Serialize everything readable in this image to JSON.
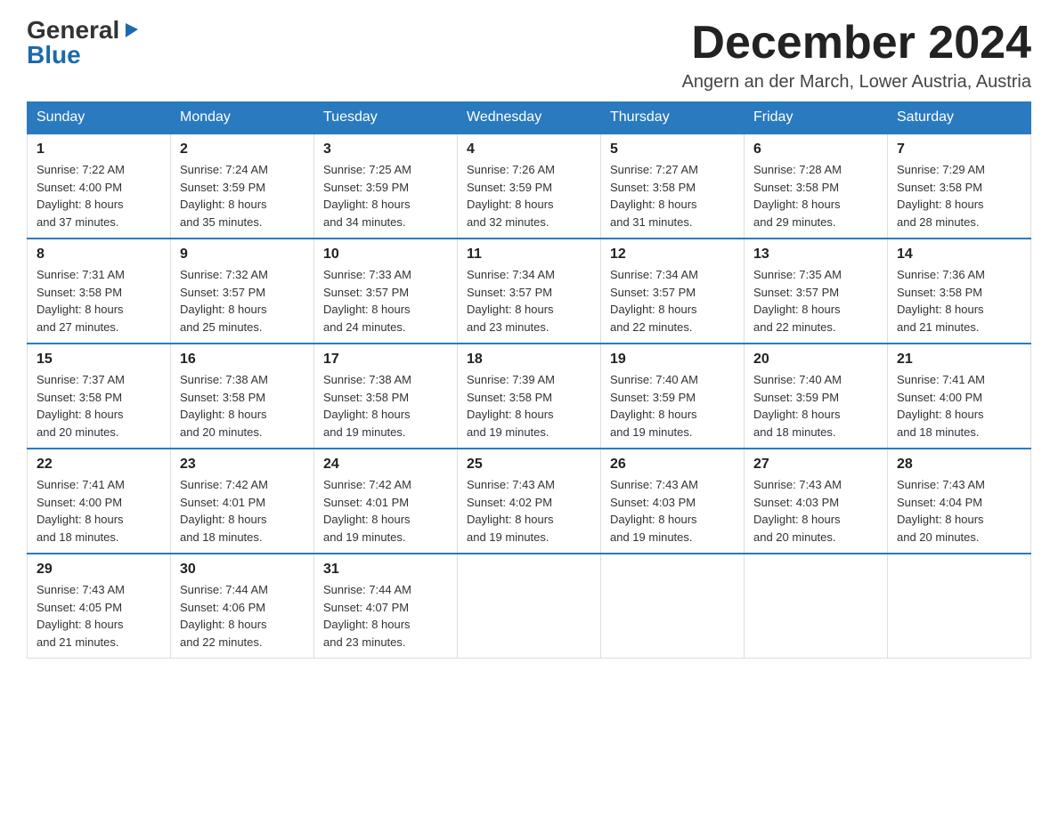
{
  "logo": {
    "general": "General",
    "blue": "Blue",
    "triangle_alt": "▶"
  },
  "header": {
    "month_title": "December 2024",
    "subtitle": "Angern an der March, Lower Austria, Austria"
  },
  "weekdays": [
    "Sunday",
    "Monday",
    "Tuesday",
    "Wednesday",
    "Thursday",
    "Friday",
    "Saturday"
  ],
  "weeks": [
    [
      {
        "day": "1",
        "sunrise": "Sunrise: 7:22 AM",
        "sunset": "Sunset: 4:00 PM",
        "daylight": "Daylight: 8 hours",
        "daylight2": "and 37 minutes."
      },
      {
        "day": "2",
        "sunrise": "Sunrise: 7:24 AM",
        "sunset": "Sunset: 3:59 PM",
        "daylight": "Daylight: 8 hours",
        "daylight2": "and 35 minutes."
      },
      {
        "day": "3",
        "sunrise": "Sunrise: 7:25 AM",
        "sunset": "Sunset: 3:59 PM",
        "daylight": "Daylight: 8 hours",
        "daylight2": "and 34 minutes."
      },
      {
        "day": "4",
        "sunrise": "Sunrise: 7:26 AM",
        "sunset": "Sunset: 3:59 PM",
        "daylight": "Daylight: 8 hours",
        "daylight2": "and 32 minutes."
      },
      {
        "day": "5",
        "sunrise": "Sunrise: 7:27 AM",
        "sunset": "Sunset: 3:58 PM",
        "daylight": "Daylight: 8 hours",
        "daylight2": "and 31 minutes."
      },
      {
        "day": "6",
        "sunrise": "Sunrise: 7:28 AM",
        "sunset": "Sunset: 3:58 PM",
        "daylight": "Daylight: 8 hours",
        "daylight2": "and 29 minutes."
      },
      {
        "day": "7",
        "sunrise": "Sunrise: 7:29 AM",
        "sunset": "Sunset: 3:58 PM",
        "daylight": "Daylight: 8 hours",
        "daylight2": "and 28 minutes."
      }
    ],
    [
      {
        "day": "8",
        "sunrise": "Sunrise: 7:31 AM",
        "sunset": "Sunset: 3:58 PM",
        "daylight": "Daylight: 8 hours",
        "daylight2": "and 27 minutes."
      },
      {
        "day": "9",
        "sunrise": "Sunrise: 7:32 AM",
        "sunset": "Sunset: 3:57 PM",
        "daylight": "Daylight: 8 hours",
        "daylight2": "and 25 minutes."
      },
      {
        "day": "10",
        "sunrise": "Sunrise: 7:33 AM",
        "sunset": "Sunset: 3:57 PM",
        "daylight": "Daylight: 8 hours",
        "daylight2": "and 24 minutes."
      },
      {
        "day": "11",
        "sunrise": "Sunrise: 7:34 AM",
        "sunset": "Sunset: 3:57 PM",
        "daylight": "Daylight: 8 hours",
        "daylight2": "and 23 minutes."
      },
      {
        "day": "12",
        "sunrise": "Sunrise: 7:34 AM",
        "sunset": "Sunset: 3:57 PM",
        "daylight": "Daylight: 8 hours",
        "daylight2": "and 22 minutes."
      },
      {
        "day": "13",
        "sunrise": "Sunrise: 7:35 AM",
        "sunset": "Sunset: 3:57 PM",
        "daylight": "Daylight: 8 hours",
        "daylight2": "and 22 minutes."
      },
      {
        "day": "14",
        "sunrise": "Sunrise: 7:36 AM",
        "sunset": "Sunset: 3:58 PM",
        "daylight": "Daylight: 8 hours",
        "daylight2": "and 21 minutes."
      }
    ],
    [
      {
        "day": "15",
        "sunrise": "Sunrise: 7:37 AM",
        "sunset": "Sunset: 3:58 PM",
        "daylight": "Daylight: 8 hours",
        "daylight2": "and 20 minutes."
      },
      {
        "day": "16",
        "sunrise": "Sunrise: 7:38 AM",
        "sunset": "Sunset: 3:58 PM",
        "daylight": "Daylight: 8 hours",
        "daylight2": "and 20 minutes."
      },
      {
        "day": "17",
        "sunrise": "Sunrise: 7:38 AM",
        "sunset": "Sunset: 3:58 PM",
        "daylight": "Daylight: 8 hours",
        "daylight2": "and 19 minutes."
      },
      {
        "day": "18",
        "sunrise": "Sunrise: 7:39 AM",
        "sunset": "Sunset: 3:58 PM",
        "daylight": "Daylight: 8 hours",
        "daylight2": "and 19 minutes."
      },
      {
        "day": "19",
        "sunrise": "Sunrise: 7:40 AM",
        "sunset": "Sunset: 3:59 PM",
        "daylight": "Daylight: 8 hours",
        "daylight2": "and 19 minutes."
      },
      {
        "day": "20",
        "sunrise": "Sunrise: 7:40 AM",
        "sunset": "Sunset: 3:59 PM",
        "daylight": "Daylight: 8 hours",
        "daylight2": "and 18 minutes."
      },
      {
        "day": "21",
        "sunrise": "Sunrise: 7:41 AM",
        "sunset": "Sunset: 4:00 PM",
        "daylight": "Daylight: 8 hours",
        "daylight2": "and 18 minutes."
      }
    ],
    [
      {
        "day": "22",
        "sunrise": "Sunrise: 7:41 AM",
        "sunset": "Sunset: 4:00 PM",
        "daylight": "Daylight: 8 hours",
        "daylight2": "and 18 minutes."
      },
      {
        "day": "23",
        "sunrise": "Sunrise: 7:42 AM",
        "sunset": "Sunset: 4:01 PM",
        "daylight": "Daylight: 8 hours",
        "daylight2": "and 18 minutes."
      },
      {
        "day": "24",
        "sunrise": "Sunrise: 7:42 AM",
        "sunset": "Sunset: 4:01 PM",
        "daylight": "Daylight: 8 hours",
        "daylight2": "and 19 minutes."
      },
      {
        "day": "25",
        "sunrise": "Sunrise: 7:43 AM",
        "sunset": "Sunset: 4:02 PM",
        "daylight": "Daylight: 8 hours",
        "daylight2": "and 19 minutes."
      },
      {
        "day": "26",
        "sunrise": "Sunrise: 7:43 AM",
        "sunset": "Sunset: 4:03 PM",
        "daylight": "Daylight: 8 hours",
        "daylight2": "and 19 minutes."
      },
      {
        "day": "27",
        "sunrise": "Sunrise: 7:43 AM",
        "sunset": "Sunset: 4:03 PM",
        "daylight": "Daylight: 8 hours",
        "daylight2": "and 20 minutes."
      },
      {
        "day": "28",
        "sunrise": "Sunrise: 7:43 AM",
        "sunset": "Sunset: 4:04 PM",
        "daylight": "Daylight: 8 hours",
        "daylight2": "and 20 minutes."
      }
    ],
    [
      {
        "day": "29",
        "sunrise": "Sunrise: 7:43 AM",
        "sunset": "Sunset: 4:05 PM",
        "daylight": "Daylight: 8 hours",
        "daylight2": "and 21 minutes."
      },
      {
        "day": "30",
        "sunrise": "Sunrise: 7:44 AM",
        "sunset": "Sunset: 4:06 PM",
        "daylight": "Daylight: 8 hours",
        "daylight2": "and 22 minutes."
      },
      {
        "day": "31",
        "sunrise": "Sunrise: 7:44 AM",
        "sunset": "Sunset: 4:07 PM",
        "daylight": "Daylight: 8 hours",
        "daylight2": "and 23 minutes."
      },
      null,
      null,
      null,
      null
    ]
  ]
}
